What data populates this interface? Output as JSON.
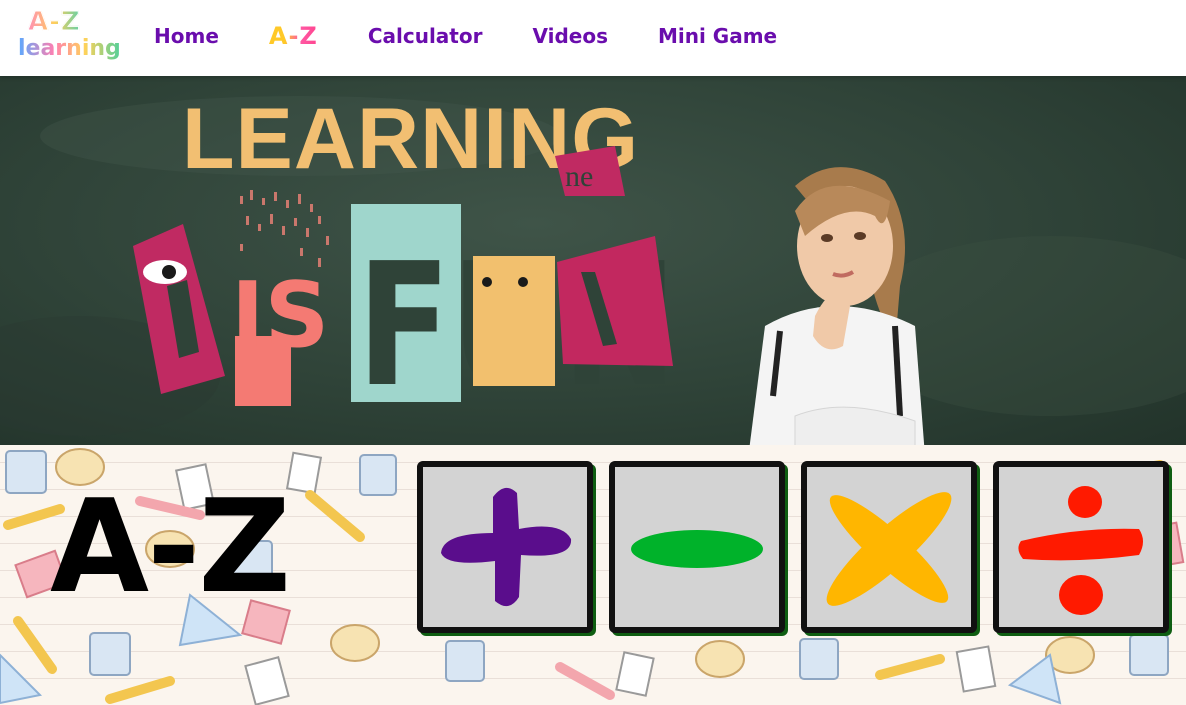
{
  "logo": {
    "line1": "A-Z",
    "line2": "learning"
  },
  "nav": {
    "items": [
      {
        "label": "Home"
      },
      {
        "label": "A-Z"
      },
      {
        "label": "Calculator"
      },
      {
        "label": "Videos"
      },
      {
        "label": "Mini Game"
      }
    ]
  },
  "hero": {
    "title": "LEARNING",
    "word_is": "IS",
    "word_fun": "FUN"
  },
  "main": {
    "heading": "A-Z",
    "operations": [
      {
        "name": "addition",
        "symbol": "+",
        "color": "#5a0d8c"
      },
      {
        "name": "subtraction",
        "symbol": "−",
        "color": "#00b22a"
      },
      {
        "name": "multiplication",
        "symbol": "×",
        "color": "#ffb600"
      },
      {
        "name": "division",
        "symbol": "÷",
        "color": "#ff1a00"
      }
    ]
  },
  "colors": {
    "nav_text": "#6a0dad",
    "chalkboard": "#2f4338",
    "title_yellow": "#f2bf72",
    "tile_bg": "#d3d3d3",
    "tile_shadow": "#0f5e12"
  }
}
